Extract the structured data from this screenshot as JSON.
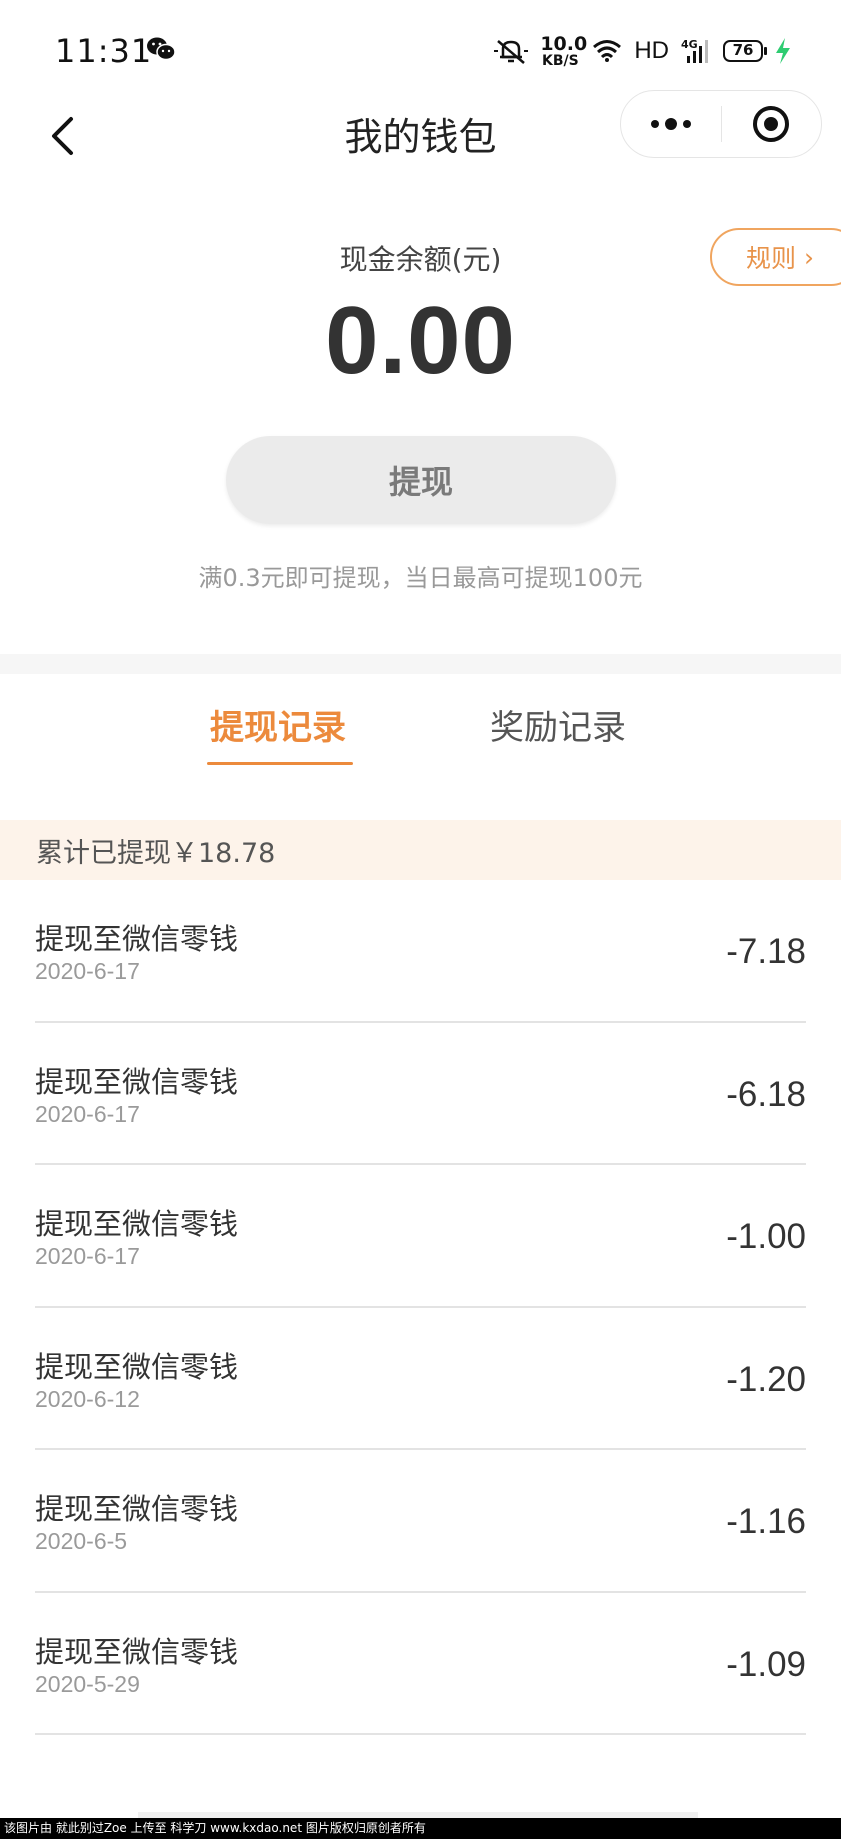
{
  "status_bar": {
    "time": "11:31",
    "net_speed_value": "10.0",
    "net_speed_unit": "KB/S",
    "hd_label": "HD",
    "network_type": "4G",
    "battery_level": "76",
    "icons": [
      "wechat-icon",
      "mute-bell-icon",
      "wifi-icon",
      "signal-icon",
      "battery-icon",
      "charging-icon"
    ]
  },
  "nav": {
    "title": "我的钱包",
    "icons": [
      "back-arrow-icon",
      "more-dots-icon",
      "close-target-icon"
    ]
  },
  "balance": {
    "label": "现金余额(元)",
    "amount": "0.00",
    "rule_label": "规则",
    "rule_chevron": "›",
    "withdraw_button": "提现",
    "withdraw_note": "满0.3元即可提现，当日最高可提现100元"
  },
  "tabs": {
    "withdraw_records": "提现记录",
    "reward_records": "奖励记录",
    "active": "withdraw_records"
  },
  "summary": {
    "total_withdrawn": "累计已提现￥18.78"
  },
  "records": [
    {
      "title": "提现至微信零钱",
      "date": "2020-6-17",
      "amount": "-7.18"
    },
    {
      "title": "提现至微信零钱",
      "date": "2020-6-17",
      "amount": "-6.18"
    },
    {
      "title": "提现至微信零钱",
      "date": "2020-6-17",
      "amount": "-1.00"
    },
    {
      "title": "提现至微信零钱",
      "date": "2020-6-12",
      "amount": "-1.20"
    },
    {
      "title": "提现至微信零钱",
      "date": "2020-6-5",
      "amount": "-1.16"
    },
    {
      "title": "提现至微信零钱",
      "date": "2020-5-29",
      "amount": "-1.09"
    }
  ],
  "watermark": "该图片由 就此别过Zoe 上传至 科学刀 www.kxdao.net 图片版权归原创者所有",
  "colors": {
    "accent": "#ec8a3c",
    "rule_border": "#f0a55f",
    "summary_bg": "#fdf3ea",
    "withdraw_btn_bg": "#ebebeb",
    "text_primary": "#333333",
    "text_secondary": "#9a9a9a"
  }
}
